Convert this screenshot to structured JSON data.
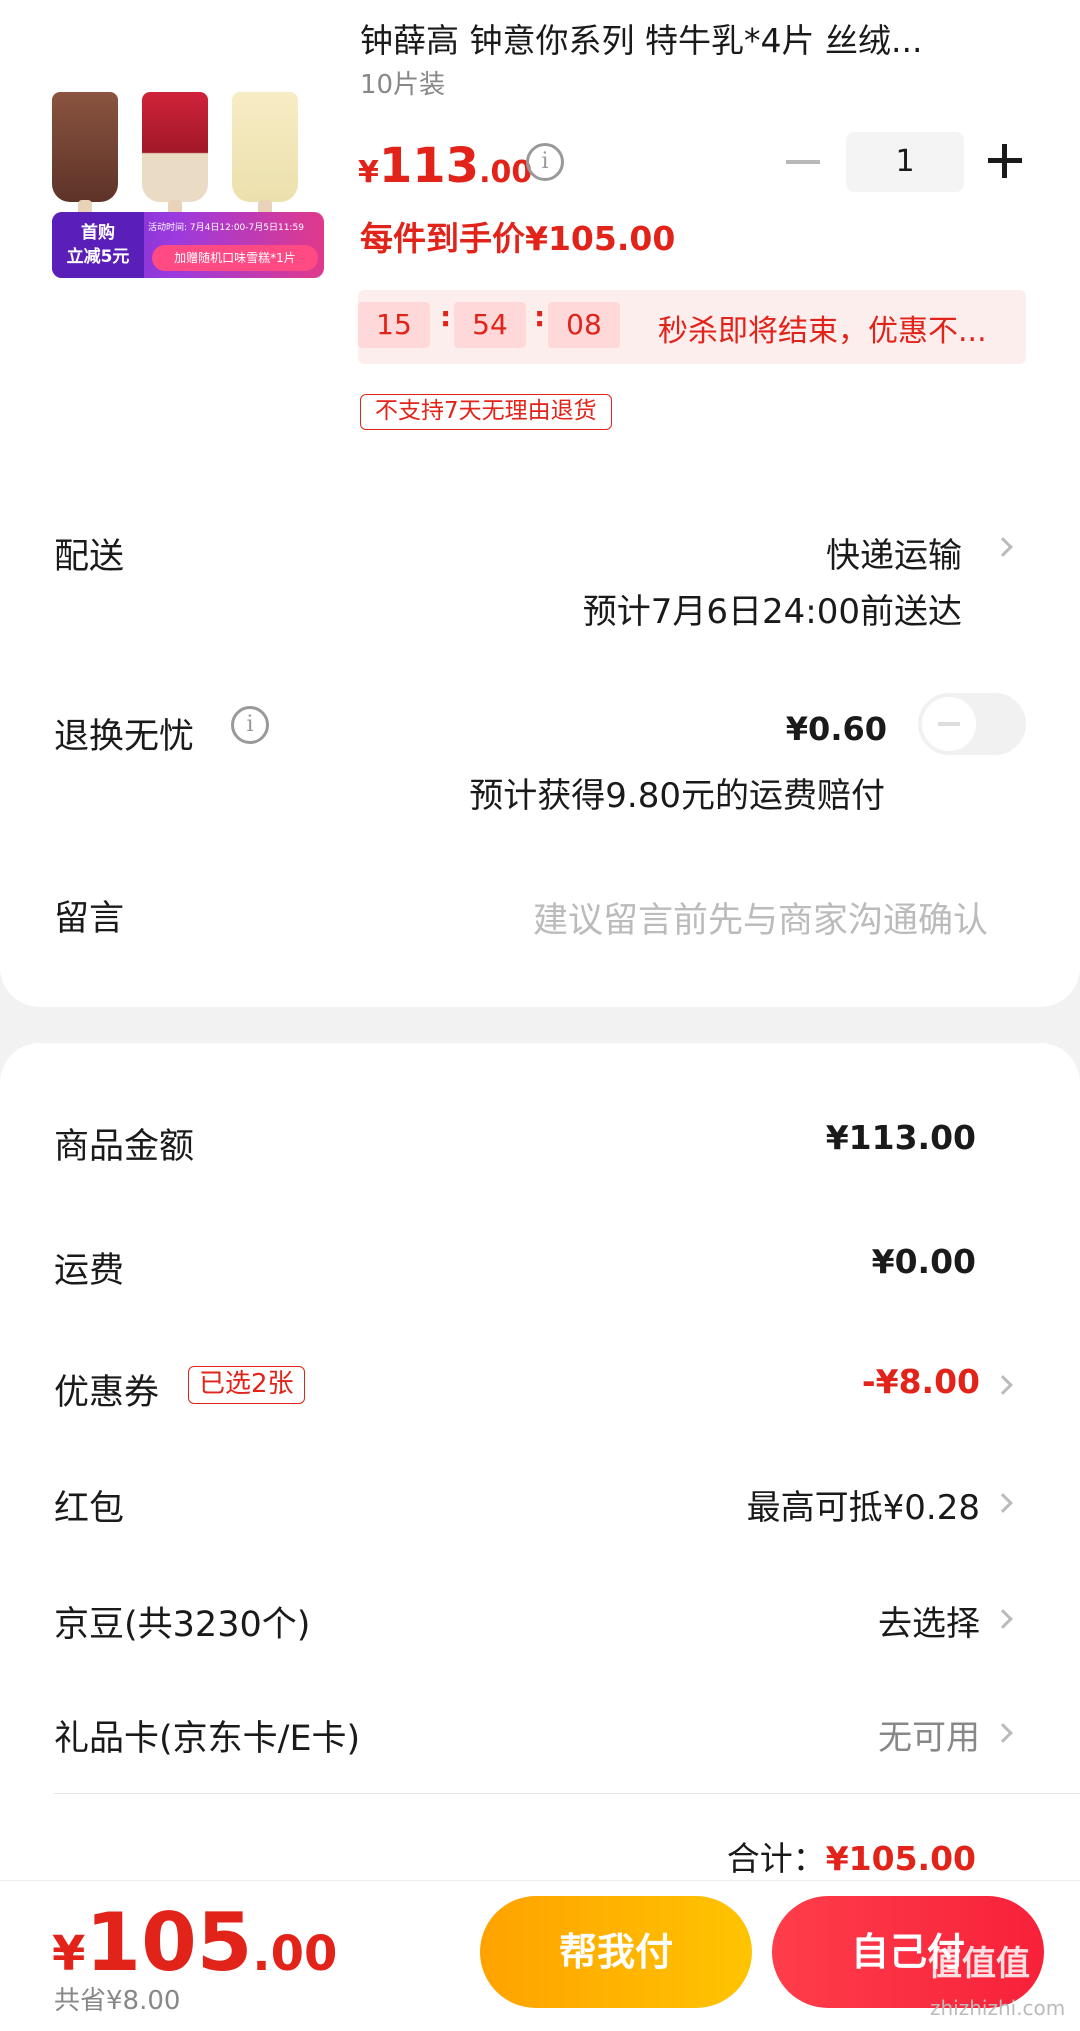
{
  "product": {
    "title": "钟薛高 钟意你系列 特牛乳*4片 丝绒...",
    "spec": "10片装",
    "price_symbol": "¥",
    "price_int": "113",
    "price_dec": ".00",
    "quantity": "1",
    "unit_price_label": "每件到手价¥105.00",
    "promo_badge_line1": "首购",
    "promo_badge_line2": "立减5元",
    "promo_time": "活动时间: 7月4日12:00-7月5日11:59",
    "promo_gift": "加赠随机口味雪糕*1片",
    "countdown": {
      "h": "15",
      "m": "54",
      "s": "08"
    },
    "flash_text": "秒杀即将结束，优惠不...",
    "no_return_tag": "不支持7天无理由退货",
    "bar_colors": [
      "#7a4a3a",
      "#c01a2e",
      "#f3e6b8"
    ]
  },
  "delivery": {
    "label": "配送",
    "method": "快递运输",
    "eta": "预计7月6日24:00前送达"
  },
  "return_insurance": {
    "label": "退换无忧",
    "info_icon": "i",
    "price": "¥0.60",
    "compensation": "预计获得9.80元的运费赔付",
    "enabled": false
  },
  "note": {
    "label": "留言",
    "placeholder": "建议留言前先与商家沟通确认"
  },
  "summary": {
    "goods_label": "商品金额",
    "goods_amount": "¥113.00",
    "shipping_label": "运费",
    "shipping_amount": "¥0.00",
    "coupon_label": "优惠券",
    "coupon_tag": "已选2张",
    "coupon_amount": "-¥8.00",
    "redpacket_label": "红包",
    "redpacket_value": "最高可抵¥0.28",
    "beans_label": "京豆(共3230个)",
    "beans_value": "去选择",
    "giftcard_label": "礼品卡(京东卡/E卡)",
    "giftcard_value": "无可用",
    "total_label": "合计：",
    "total_amount": "¥105.00"
  },
  "bottom_bar": {
    "total_symbol": "¥",
    "total_int": "105",
    "total_dec": ".00",
    "saved": "共省¥8.00",
    "help_pay": "帮我付",
    "self_pay": "自己付",
    "watermark": "值值值",
    "watermark_site": "zhizhizhi.com"
  },
  "colors": {
    "accent": "#e2231a",
    "help_btn": "#ffb000",
    "self_btn": "#f7213a"
  }
}
